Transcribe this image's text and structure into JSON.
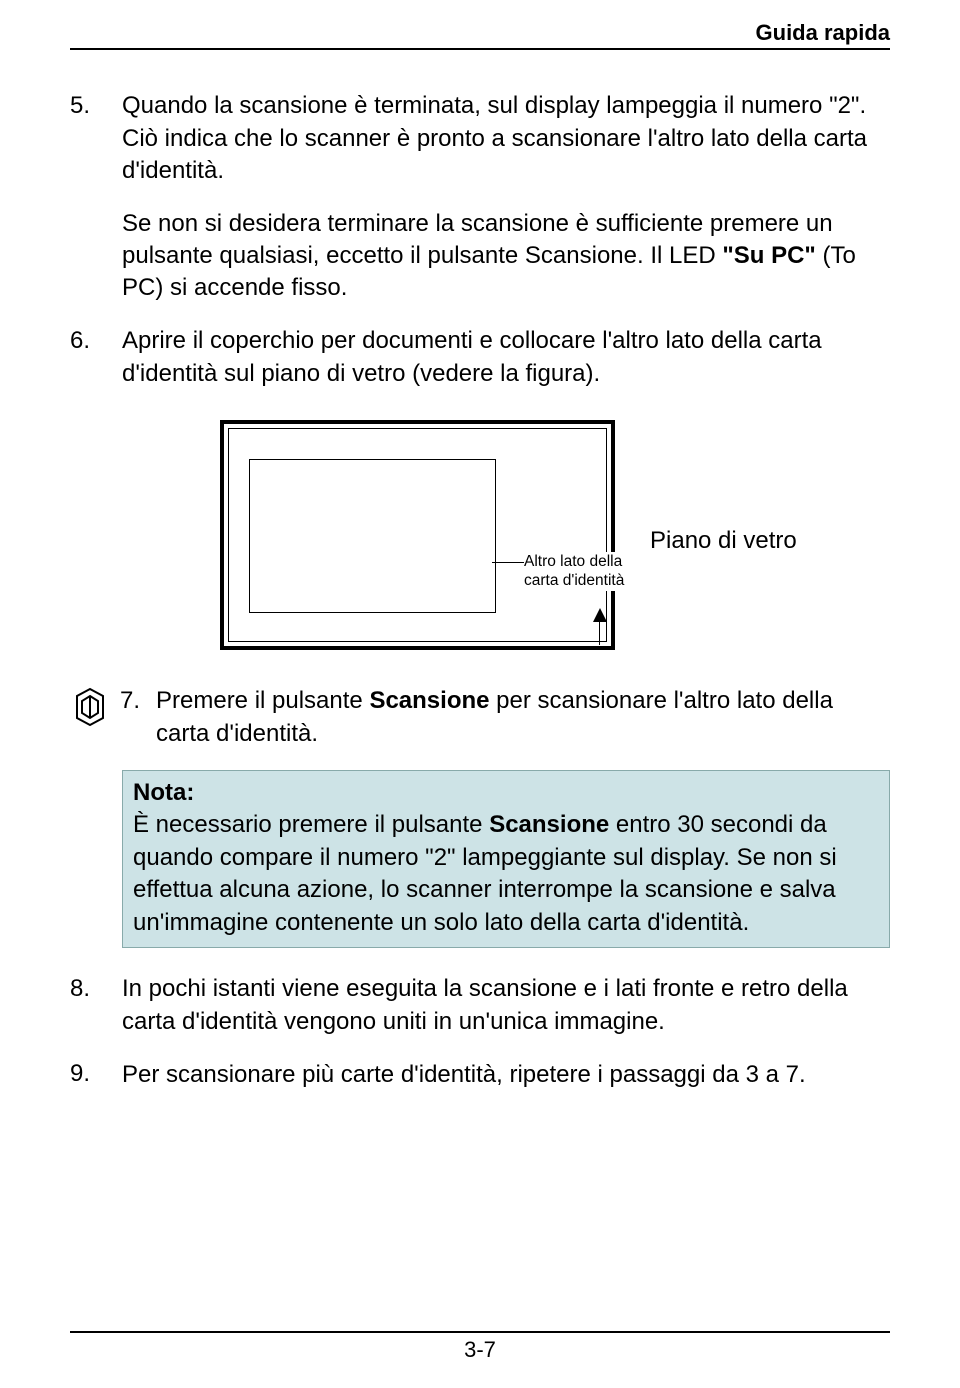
{
  "header": {
    "title": "Guida rapida"
  },
  "items": {
    "i5_num": "5.",
    "i5_text": "Quando la scansione è terminata, sul display lampeggia il numero \"2\". Ciò indica che lo scanner è pronto a scansionare l'altro lato della carta d'identità.",
    "i5b_text_a": "Se non si desidera terminare la scansione è sufficiente premere un pulsante qualsiasi, eccetto il pulsante Scansione. Il LED  ",
    "i5b_bold": "\"Su PC\"",
    "i5b_text_b": " (To PC) si accende fisso.",
    "i6_num": "6.",
    "i6_text": "Aprire il coperchio per documenti e collocare l'altro lato della carta d'identità sul piano di vetro (vedere la figura).",
    "diagram": {
      "card_label": "Altro lato della carta d'identità",
      "glass_label": "Piano di vetro"
    },
    "i7_num": "7.",
    "i7_text_a": "Premere il pulsante ",
    "i7_bold": "Scansione",
    "i7_text_b": " per scansionare l'altro lato della carta d'identità.",
    "note_title": "Nota:",
    "note_text_a": "È necessario premere il pulsante ",
    "note_bold": "Scansione",
    "note_text_b": " entro 30 secondi da quando compare il numero \"2\" lampeggiante sul display. Se non si effettua alcuna azione, lo scanner interrompe la scansione e salva un'immagine contenente un solo lato della carta d'identità.",
    "i8_num": "8.",
    "i8_text": "In pochi istanti viene eseguita la scansione e i lati fronte e retro della carta d'identità vengono uniti in un'unica immagine.",
    "i9_num": "9.",
    "i9_text": "Per scansionare più carte d'identità, ripetere i passaggi da 3 a 7."
  },
  "footer": {
    "page": "3-7"
  }
}
